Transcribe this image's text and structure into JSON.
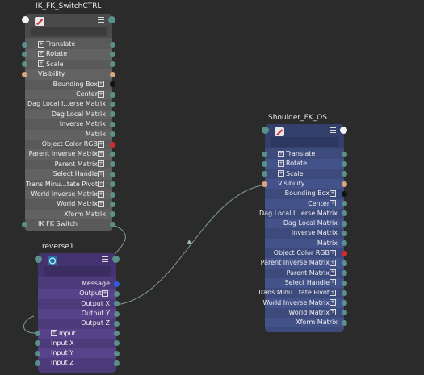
{
  "colors": {
    "background": "#2b2b2b",
    "transform_node_body": "#5a5a5a",
    "transform_node_row_alt": "#626262",
    "transform_node_header": "#4a4a4a",
    "shoulder_node_body": "#3d4a7c",
    "shoulder_node_row_alt": "#44528a",
    "reverse_node_body": "#4d3a7a",
    "reverse_node_row_alt": "#56438a",
    "port_teal": "#5a8f8a",
    "port_peach": "#d9a47a",
    "port_black": "#111111",
    "port_red": "#d42a2a",
    "port_blue": "#2e5ddf",
    "wire": "#7f9d8c"
  },
  "nodes": {
    "ik_fk_switch_ctrl": {
      "title": "IK_FK_SwitchCTRL",
      "icon": "transform-icon",
      "rows": [
        {
          "label": "Translate",
          "side": "left",
          "expand": true,
          "in_port": "teal",
          "out_port": "teal"
        },
        {
          "label": "Rotate",
          "side": "left",
          "expand": true,
          "in_port": "teal",
          "out_port": "teal"
        },
        {
          "label": "Scale",
          "side": "left",
          "expand": true,
          "in_port": "teal",
          "out_port": "teal"
        },
        {
          "label": "Visibility",
          "side": "left",
          "expand": false,
          "in_port": "peach",
          "out_port": "peach"
        },
        {
          "label": "Bounding Box",
          "side": "right",
          "expand": true,
          "in_port": null,
          "out_port": "black"
        },
        {
          "label": "Center",
          "side": "right",
          "expand": true,
          "in_port": null,
          "out_port": "teal"
        },
        {
          "label": "Dag Local I...erse Matrix",
          "side": "right",
          "expand": false,
          "in_port": null,
          "out_port": "teal"
        },
        {
          "label": "Dag Local Matrix",
          "side": "right",
          "expand": false,
          "in_port": null,
          "out_port": "teal"
        },
        {
          "label": "Inverse Matrix",
          "side": "right",
          "expand": false,
          "in_port": null,
          "out_port": "teal"
        },
        {
          "label": "Matrix",
          "side": "right",
          "expand": false,
          "in_port": null,
          "out_port": "teal"
        },
        {
          "label": "Object Color RGB",
          "side": "right",
          "expand": true,
          "in_port": null,
          "out_port": "red"
        },
        {
          "label": "Parent Inverse Matrix",
          "side": "right",
          "expand": true,
          "in_port": null,
          "out_port": "teal"
        },
        {
          "label": "Parent Matrix",
          "side": "right",
          "expand": true,
          "in_port": null,
          "out_port": "teal"
        },
        {
          "label": "Select Handle",
          "side": "right",
          "expand": true,
          "in_port": null,
          "out_port": "teal"
        },
        {
          "label": "Trans Minu...tate Pivot",
          "side": "right",
          "expand": true,
          "in_port": null,
          "out_port": "teal"
        },
        {
          "label": "World Inverse Matrix",
          "side": "right",
          "expand": true,
          "in_port": null,
          "out_port": "teal"
        },
        {
          "label": "World Matrix",
          "side": "right",
          "expand": true,
          "in_port": null,
          "out_port": "teal"
        },
        {
          "label": "Xform Matrix",
          "side": "right",
          "expand": false,
          "in_port": null,
          "out_port": "teal"
        },
        {
          "label": "IK FK Switch",
          "side": "left",
          "expand": false,
          "in_port": "teal",
          "out_port": "teal"
        }
      ]
    },
    "shoulder_fk_os": {
      "title": "Shoulder_FK_OS",
      "icon": "transform-icon",
      "rows": [
        {
          "label": "Translate",
          "side": "left",
          "expand": true,
          "in_port": "teal",
          "out_port": "teal"
        },
        {
          "label": "Rotate",
          "side": "left",
          "expand": true,
          "in_port": "teal",
          "out_port": "teal"
        },
        {
          "label": "Scale",
          "side": "left",
          "expand": true,
          "in_port": "teal",
          "out_port": "teal"
        },
        {
          "label": "Visibility",
          "side": "left",
          "expand": false,
          "in_port": "peach",
          "out_port": "peach"
        },
        {
          "label": "Bounding Box",
          "side": "right",
          "expand": true,
          "in_port": null,
          "out_port": "black"
        },
        {
          "label": "Center",
          "side": "right",
          "expand": true,
          "in_port": null,
          "out_port": "teal"
        },
        {
          "label": "Dag Local I...erse Matrix",
          "side": "right",
          "expand": false,
          "in_port": null,
          "out_port": "teal"
        },
        {
          "label": "Dag Local Matrix",
          "side": "right",
          "expand": false,
          "in_port": null,
          "out_port": "teal"
        },
        {
          "label": "Inverse Matrix",
          "side": "right",
          "expand": false,
          "in_port": null,
          "out_port": "teal"
        },
        {
          "label": "Matrix",
          "side": "right",
          "expand": false,
          "in_port": null,
          "out_port": "teal"
        },
        {
          "label": "Object Color RGB",
          "side": "right",
          "expand": true,
          "in_port": null,
          "out_port": "red"
        },
        {
          "label": "Parent Inverse Matrix",
          "side": "right",
          "expand": true,
          "in_port": null,
          "out_port": "teal"
        },
        {
          "label": "Parent Matrix",
          "side": "right",
          "expand": true,
          "in_port": null,
          "out_port": "teal"
        },
        {
          "label": "Select Handle",
          "side": "right",
          "expand": true,
          "in_port": null,
          "out_port": "teal"
        },
        {
          "label": "Trans Minu...tate Pivot",
          "side": "right",
          "expand": true,
          "in_port": null,
          "out_port": "teal"
        },
        {
          "label": "World Inverse Matrix",
          "side": "right",
          "expand": true,
          "in_port": null,
          "out_port": "teal"
        },
        {
          "label": "World Matrix",
          "side": "right",
          "expand": true,
          "in_port": null,
          "out_port": "teal"
        },
        {
          "label": "Xform Matrix",
          "side": "right",
          "expand": false,
          "in_port": null,
          "out_port": "teal"
        }
      ]
    },
    "reverse1": {
      "title": "reverse1",
      "icon": "reverse-icon",
      "rows": [
        {
          "label": "Message",
          "side": "right",
          "expand": false,
          "in_port": null,
          "out_port": "blue"
        },
        {
          "label": "Output",
          "side": "right",
          "expand": true,
          "in_port": null,
          "out_port": "teal"
        },
        {
          "label": "Output X",
          "side": "right",
          "expand": false,
          "in_port": null,
          "out_port": "teal"
        },
        {
          "label": "Output Y",
          "side": "right",
          "expand": false,
          "in_port": null,
          "out_port": "teal"
        },
        {
          "label": "Output Z",
          "side": "right",
          "expand": false,
          "in_port": null,
          "out_port": "teal"
        },
        {
          "label": "Input",
          "side": "left",
          "expand": true,
          "in_port": "teal",
          "out_port": "teal"
        },
        {
          "label": "Input X",
          "side": "left",
          "expand": false,
          "in_port": "teal",
          "out_port": "teal"
        },
        {
          "label": "Input Y",
          "side": "left",
          "expand": false,
          "in_port": "teal",
          "out_port": "teal"
        },
        {
          "label": "Input Z",
          "side": "left",
          "expand": false,
          "in_port": "teal",
          "out_port": "teal"
        }
      ]
    }
  }
}
